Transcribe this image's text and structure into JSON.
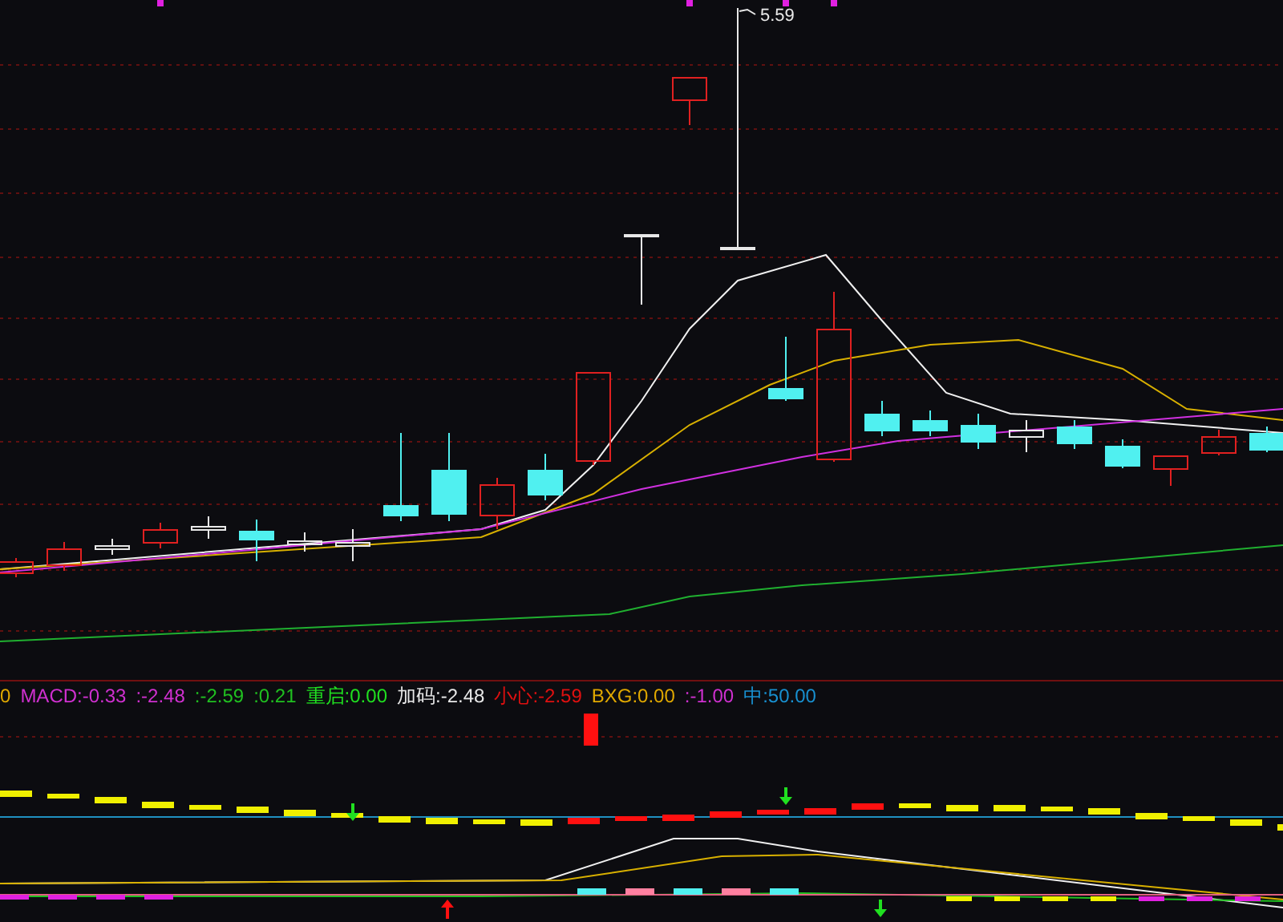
{
  "price_chart": {
    "peak_label": "5.59"
  },
  "indicator_legend": [
    {
      "text": "0",
      "color": "#e0a800"
    },
    {
      "text": "MACD:-0.33",
      "color": "#d030d0"
    },
    {
      "text": ":-2.48",
      "color": "#d030d0"
    },
    {
      "text": ":-2.59",
      "color": "#20c020"
    },
    {
      "text": ":0.21",
      "color": "#20c020"
    },
    {
      "text": "重启:0.00",
      "color": "#20e020"
    },
    {
      "text": "加码:-2.48",
      "color": "#e8e8e8"
    },
    {
      "text": "小心:-2.59",
      "color": "#e01010"
    },
    {
      "text": "BXG:0.00",
      "color": "#e0a800"
    },
    {
      "text": ":-1.00",
      "color": "#d030d0"
    },
    {
      "text": "中:50.00",
      "color": "#1890d0"
    }
  ]
}
